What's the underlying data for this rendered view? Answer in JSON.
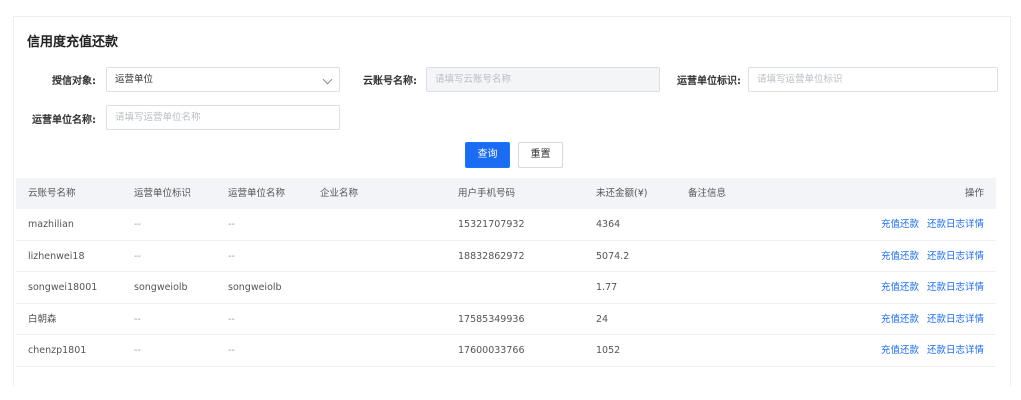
{
  "title": "信用度充值还款",
  "form": {
    "grant_target": {
      "label": "授信对象:",
      "value": "运营单位"
    },
    "cloud_account": {
      "label": "云账号名称:",
      "placeholder": "请填写云账号名称"
    },
    "unit_code": {
      "label": "运营单位标识:",
      "placeholder": "请填写运营单位标识"
    },
    "unit_name": {
      "label": "运营单位名称:",
      "placeholder": "请填写运营单位名称"
    }
  },
  "buttons": {
    "search": "查询",
    "reset": "重置"
  },
  "table": {
    "headers": [
      "云账号名称",
      "运营单位标识",
      "运营单位名称",
      "企业名称",
      "用户手机号码",
      "未还金额(¥)",
      "备注信息",
      "操作"
    ],
    "rows": [
      {
        "account": "mazhilian",
        "unit_code": "--",
        "unit_name": "--",
        "company": "",
        "phone": "15321707932",
        "amount": "4364",
        "remark": ""
      },
      {
        "account": "lizhenwei18",
        "unit_code": "--",
        "unit_name": "--",
        "company": "",
        "phone": "18832862972",
        "amount": "5074.2",
        "remark": ""
      },
      {
        "account": "songwei18001",
        "unit_code": "songweiolb",
        "unit_name": "songweiolb",
        "company": "",
        "phone": "",
        "amount": "1.77",
        "remark": ""
      },
      {
        "account": "白朝森",
        "unit_code": "--",
        "unit_name": "--",
        "company": "",
        "phone": "17585349936",
        "amount": "24",
        "remark": ""
      },
      {
        "account": "chenzp1801",
        "unit_code": "--",
        "unit_name": "--",
        "company": "",
        "phone": "17600033766",
        "amount": "1052",
        "remark": ""
      }
    ],
    "actions": {
      "recharge": "充值还款",
      "log": "还款日志详情"
    }
  }
}
